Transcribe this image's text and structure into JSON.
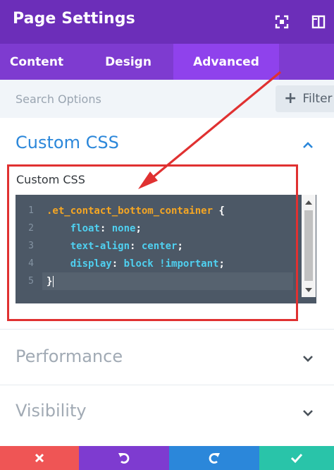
{
  "header": {
    "title": "Page Settings"
  },
  "tabs": [
    {
      "label": "Content",
      "active": false
    },
    {
      "label": "Design",
      "active": false
    },
    {
      "label": "Advanced",
      "active": true
    }
  ],
  "search": {
    "placeholder": "Search Options",
    "value": ""
  },
  "filter": {
    "label": "Filter"
  },
  "sections": [
    {
      "title": "Custom CSS",
      "expanded": true
    },
    {
      "title": "Performance",
      "expanded": false
    },
    {
      "title": "Visibility",
      "expanded": false
    }
  ],
  "custom_css": {
    "field_label": "Custom CSS",
    "lines": [
      {
        "n": "1",
        "selector": ".et_contact_bottom_container",
        "brace": " {"
      },
      {
        "n": "2",
        "prop": "float",
        "val": "none"
      },
      {
        "n": "3",
        "prop": "text-align",
        "val": "center"
      },
      {
        "n": "4",
        "prop": "display",
        "val": "block !important"
      },
      {
        "n": "5",
        "close": "}"
      }
    ]
  },
  "colors": {
    "header": "#6c2eb9",
    "tabs": "#7e3bd0",
    "active_tab": "#8f42ec",
    "section_active": "#2b87da",
    "annotation_red": "#e03131",
    "close_button": "#ef5555",
    "undo_button": "#7e3bd0",
    "redo_button": "#2b87da",
    "save_button": "#29c4a9"
  },
  "icons": {
    "header": [
      "expand-icon",
      "sidebar-toggle-icon"
    ],
    "footer": [
      "close-icon",
      "undo-icon",
      "redo-icon",
      "check-icon"
    ]
  }
}
